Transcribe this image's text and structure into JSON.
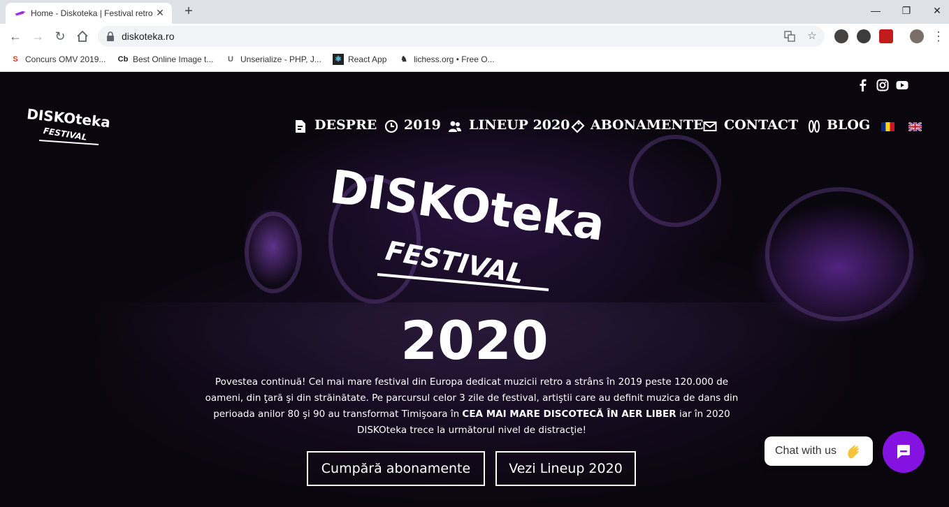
{
  "browser": {
    "tab_title": "Home - Diskoteka | Festival retro",
    "url": "diskoteka.ro",
    "window_controls": {
      "minimize": "—",
      "restore": "❐",
      "close": "✕"
    },
    "bookmarks": [
      {
        "icon": "s-logo-icon",
        "label": "Concurs OMV 2019..."
      },
      {
        "icon": "cb-icon",
        "label": "Best Online Image t..."
      },
      {
        "icon": "u-icon",
        "label": "Unserialize - PHP, J..."
      },
      {
        "icon": "react-icon",
        "label": "React App"
      },
      {
        "icon": "lichess-icon",
        "label": "lichess.org • Free O..."
      }
    ]
  },
  "site": {
    "social": [
      "facebook-icon",
      "instagram-icon",
      "youtube-icon"
    ],
    "nav": [
      {
        "icon": "document-icon",
        "label": "DESPRE"
      },
      {
        "icon": "clock-icon",
        "label": "2019"
      },
      {
        "icon": "users-icon",
        "label": "LINEUP 2020"
      },
      {
        "icon": "ticket-icon",
        "label": "ABONAMENTE"
      },
      {
        "icon": "envelope-icon",
        "label": "CONTACT"
      },
      {
        "icon": "flip-flops-icon",
        "label": "BLOG"
      }
    ],
    "languages": [
      "ro-flag",
      "en-flag"
    ],
    "logo_word": "DISKOteka",
    "logo_sub": "FESTIVAL",
    "year": "2020",
    "description_part1": "Povestea continuă! Cel mai mare festival din Europa dedicat muzicii retro a strâns în 2019 peste 120.000 de oameni, din ţară şi din străinătate. Pe parcursul celor 3 zile de festival, artiştii care au definit muzica de dans din perioada anilor 80 şi 90 au transformat Timişoara în ",
    "description_bold": "CEA MAI MARE DISCOTECĂ ÎN AER LIBER",
    "description_part2": " iar în 2020 DISKOteka trece la următorul nivel de distracţie!",
    "cta_primary": "Cumpără abonamente",
    "cta_secondary": "Vezi Lineup 2020",
    "chat_label": "Chat with us",
    "colors": {
      "chat_accent": "#8412e0",
      "hero_bg": "#0a060e"
    }
  }
}
